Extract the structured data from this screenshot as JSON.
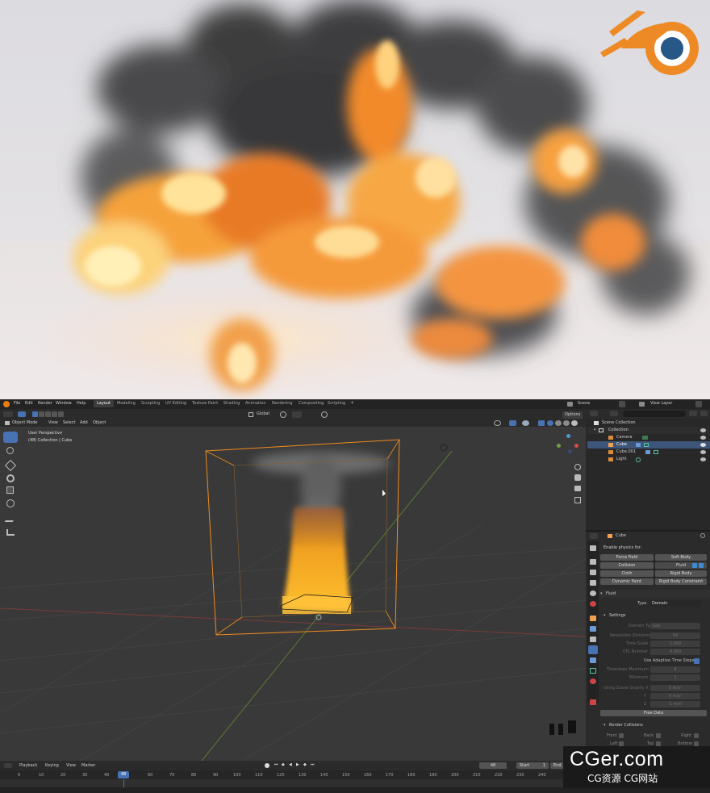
{
  "menus": [
    "File",
    "Edit",
    "Render",
    "Window",
    "Help"
  ],
  "workspaces": [
    "Layout",
    "Modeling",
    "Sculpting",
    "UV Editing",
    "Texture Paint",
    "Shading",
    "Animation",
    "Rendering",
    "Compositing",
    "Scripting"
  ],
  "workspace_add": "+",
  "scene": "Scene",
  "view_layer": "View Layer",
  "viewport": {
    "mode": "Object Mode",
    "menu": [
      "View",
      "Select",
      "Add",
      "Object"
    ],
    "orientation": "Global",
    "options": "Options",
    "perspective": "User Perspective",
    "info": "(48) Collection | Cube"
  },
  "outliner": {
    "scene_collection": "Scene Collection",
    "items": [
      {
        "label": "Collection"
      },
      {
        "label": "Camera"
      },
      {
        "label": "Cube"
      },
      {
        "label": "Cube.001"
      },
      {
        "label": "Light"
      }
    ]
  },
  "properties": {
    "object": "Cube",
    "enable_physics": "Enable physics for:",
    "physics_buttons": [
      "Force Field",
      "Soft Body",
      "Collision",
      "Fluid",
      "Cloth",
      "Rigid Body",
      "Dynamic Paint",
      "Rigid Body Constraint"
    ],
    "fluid_panel": "Fluid",
    "type_label": "Type",
    "type_value": "Domain",
    "settings": "Settings",
    "rows": [
      {
        "label": "Domain Type",
        "value": "Gas"
      },
      {
        "label": "Resolution Divisions",
        "value": "64"
      },
      {
        "label": "Time Scale",
        "value": "1.000"
      },
      {
        "label": "CFL Number",
        "value": "4.000"
      }
    ],
    "adaptive": "Use Adaptive Time Steps",
    "rows2": [
      {
        "label": "Timesteps Maximum",
        "value": "4"
      },
      {
        "label": "Minimum",
        "value": "1"
      }
    ],
    "gravity_label": "Using Scene Gravity X",
    "gravity": [
      {
        "label": "",
        "value": "0 m/s²"
      },
      {
        "label": "Y",
        "value": "0 m/s²"
      },
      {
        "label": "Z",
        "value": "-1 m/s²"
      }
    ],
    "free_data": "Free Data",
    "border": "Border Collisions",
    "border_row1": [
      "Front",
      "Back",
      "Right"
    ],
    "border_row2": [
      "Left",
      "Top",
      "Bottom"
    ]
  },
  "timeline": {
    "menu": [
      "Playback",
      "Keying",
      "View",
      "Marker"
    ],
    "current_frame": "48",
    "start_label": "Start",
    "start": "1",
    "end_label": "End",
    "ticks": [
      "0",
      "10",
      "20",
      "30",
      "40",
      "50",
      "60",
      "70",
      "80",
      "90",
      "100",
      "110",
      "120",
      "130",
      "140",
      "150",
      "160",
      "170",
      "180",
      "190",
      "200",
      "210",
      "220",
      "230",
      "240"
    ],
    "current_marker": "48"
  },
  "watermark": {
    "main": "CGer.com",
    "sub": "CG资源  CG网站"
  },
  "colors": {
    "selection": "#f08c1e",
    "active_row": "#3d5578",
    "accent": "#4772b3",
    "fluid": "#3e8bd4"
  }
}
